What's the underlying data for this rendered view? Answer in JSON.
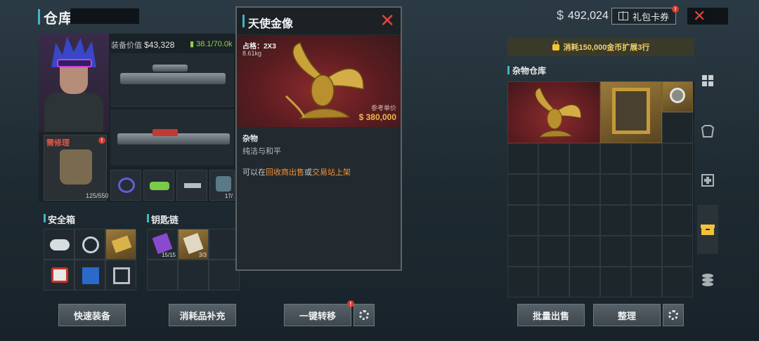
{
  "header": {
    "title": "仓库",
    "money_symbol": "$",
    "money": "492,024",
    "gift_button": "礼包卡券",
    "gift_badge": "!",
    "close_icon": "close-x-icon"
  },
  "equipment": {
    "value_label": "装备价值",
    "value": "$43,328",
    "weight": "38.1/70.0k",
    "repair_label": "需修理",
    "repair_badge": "!",
    "durability": "125/550",
    "extra_slot_count": "17/"
  },
  "safe_box": {
    "label": "安全箱"
  },
  "keychain": {
    "label": "钥匙链",
    "items": [
      {
        "count": "15/15"
      },
      {
        "count": "3/3"
      }
    ]
  },
  "popup": {
    "title": "天使金像",
    "size": "占格：2X3",
    "weight": "8.61kg",
    "ref_label": "参考单价",
    "price": "$ 380,000",
    "category": "杂物",
    "description": "纯洁与和平",
    "sell_prefix": "可以在",
    "sell_place1": "回收商出售",
    "sell_mid": "或",
    "sell_place2": "交易站上架"
  },
  "warehouse": {
    "expand_text": "消耗150,000金币扩展3行",
    "label": "杂物仓库"
  },
  "buttons": {
    "quick_equip": "快速装备",
    "consumable_refill": "消耗品补充",
    "one_click_transfer": "一键转移",
    "transfer_badge": "!",
    "batch_sell": "批量出售",
    "sort": "整理"
  },
  "colors": {
    "accent": "#3fb7c4",
    "price": "#f2b54a",
    "warning": "#e0463a",
    "highlight": "#f0913a"
  }
}
